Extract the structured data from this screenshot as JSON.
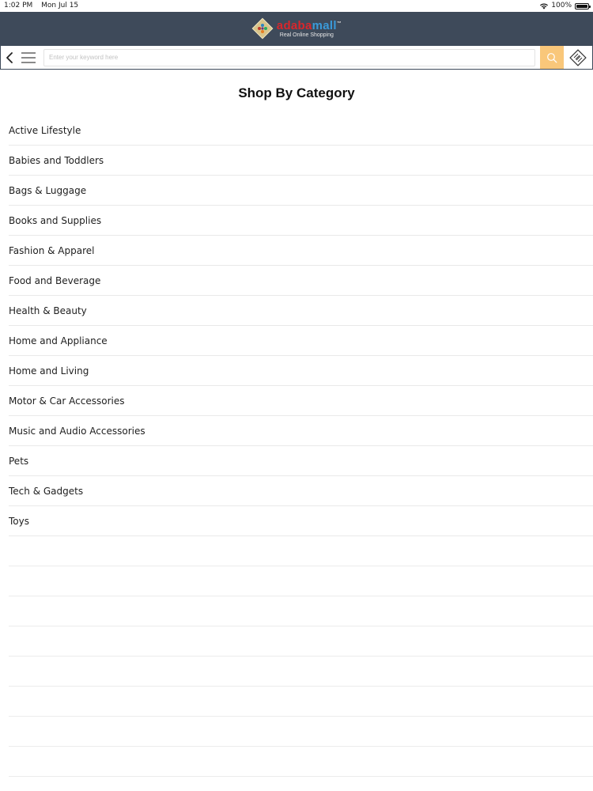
{
  "status_bar": {
    "time": "1:02 PM",
    "date": "Mon Jul 15",
    "battery": "100%",
    "wifi_icon": "wifi-icon",
    "battery_icon": "battery-icon"
  },
  "header": {
    "logo_name_part1": "adaba",
    "logo_name_part2": "mall",
    "logo_tagline": "Real Online Shopping",
    "logo_trademark": "™",
    "background_color": "#3e4a5a"
  },
  "toolbar": {
    "back_icon": "chevron-left-icon",
    "menu_icon": "hamburger-menu-icon",
    "search": {
      "value": "",
      "placeholder": "Enter your keyword here"
    },
    "search_icon": "search-icon",
    "search_button_color": "#f9c77a",
    "scan_icon": "scan-icon"
  },
  "main": {
    "title": "Shop By Category",
    "categories": [
      {
        "label": "Active Lifestyle"
      },
      {
        "label": "Babies and Toddlers"
      },
      {
        "label": "Bags & Luggage"
      },
      {
        "label": "Books and Supplies"
      },
      {
        "label": "Fashion & Apparel"
      },
      {
        "label": "Food and Beverage"
      },
      {
        "label": "Health & Beauty"
      },
      {
        "label": "Home and Appliance"
      },
      {
        "label": "Home and Living"
      },
      {
        "label": "Motor & Car Accessories"
      },
      {
        "label": "Music and Audio Accessories"
      },
      {
        "label": "Pets"
      },
      {
        "label": "Tech & Gadgets"
      },
      {
        "label": "Toys"
      }
    ]
  }
}
